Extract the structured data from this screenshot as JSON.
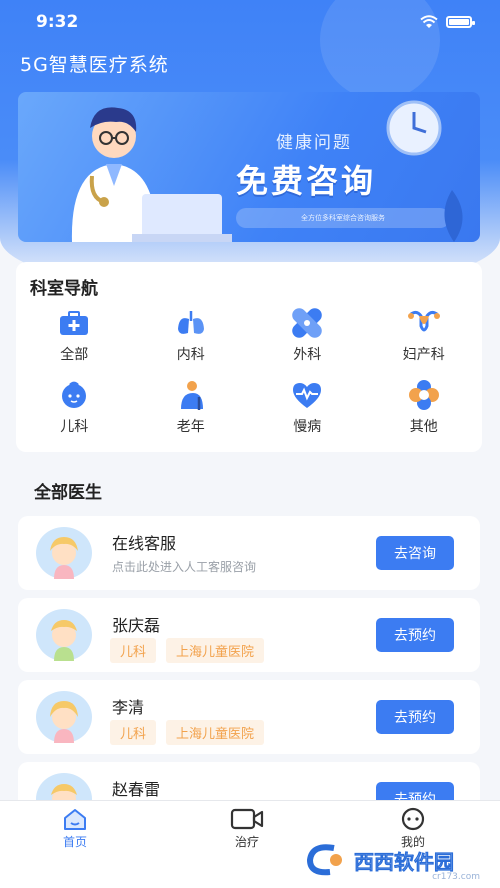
{
  "status_bar": {
    "time": "9:32"
  },
  "app": {
    "title": "5G智慧医疗系统"
  },
  "banner": {
    "subtitle": "健康问题",
    "headline": "免费咨询",
    "pill_text": "全方位多科室综合咨询服务"
  },
  "departments": {
    "title": "科室导航",
    "items": [
      {
        "label": "全部",
        "icon": "medical-kit-icon"
      },
      {
        "label": "内科",
        "icon": "lungs-icon"
      },
      {
        "label": "外科",
        "icon": "bandage-icon"
      },
      {
        "label": "妇产科",
        "icon": "uterus-icon"
      },
      {
        "label": "儿科",
        "icon": "baby-face-icon"
      },
      {
        "label": "老年",
        "icon": "elderly-icon"
      },
      {
        "label": "慢病",
        "icon": "heart-pulse-icon"
      },
      {
        "label": "其他",
        "icon": "flower-icon"
      }
    ]
  },
  "doctors": {
    "title": "全部医生",
    "list": [
      {
        "name": "在线客服",
        "desc": "点击此处进入人工客服咨询",
        "button": "去咨询"
      },
      {
        "name": "张庆磊",
        "tags": [
          "儿科",
          "上海儿童医院"
        ],
        "button": "去预约"
      },
      {
        "name": "李清",
        "tags": [
          "儿科",
          "上海儿童医院"
        ],
        "button": "去预约"
      },
      {
        "name": "赵春雷",
        "button": "去预约"
      }
    ]
  },
  "tabbar": {
    "items": [
      {
        "label": "首页",
        "icon": "home-icon",
        "active": true
      },
      {
        "label": "治疗",
        "icon": "video-camera-icon",
        "active": false
      },
      {
        "label": "我的",
        "icon": "profile-icon",
        "active": false
      }
    ]
  },
  "watermark": {
    "text": "西西软件园",
    "sub": "cr173.com"
  },
  "colors": {
    "primary": "#3c7cf2",
    "tag_bg": "#fdf2e6",
    "tag_text": "#f2a24c",
    "page_bg": "#f4f6fa"
  }
}
